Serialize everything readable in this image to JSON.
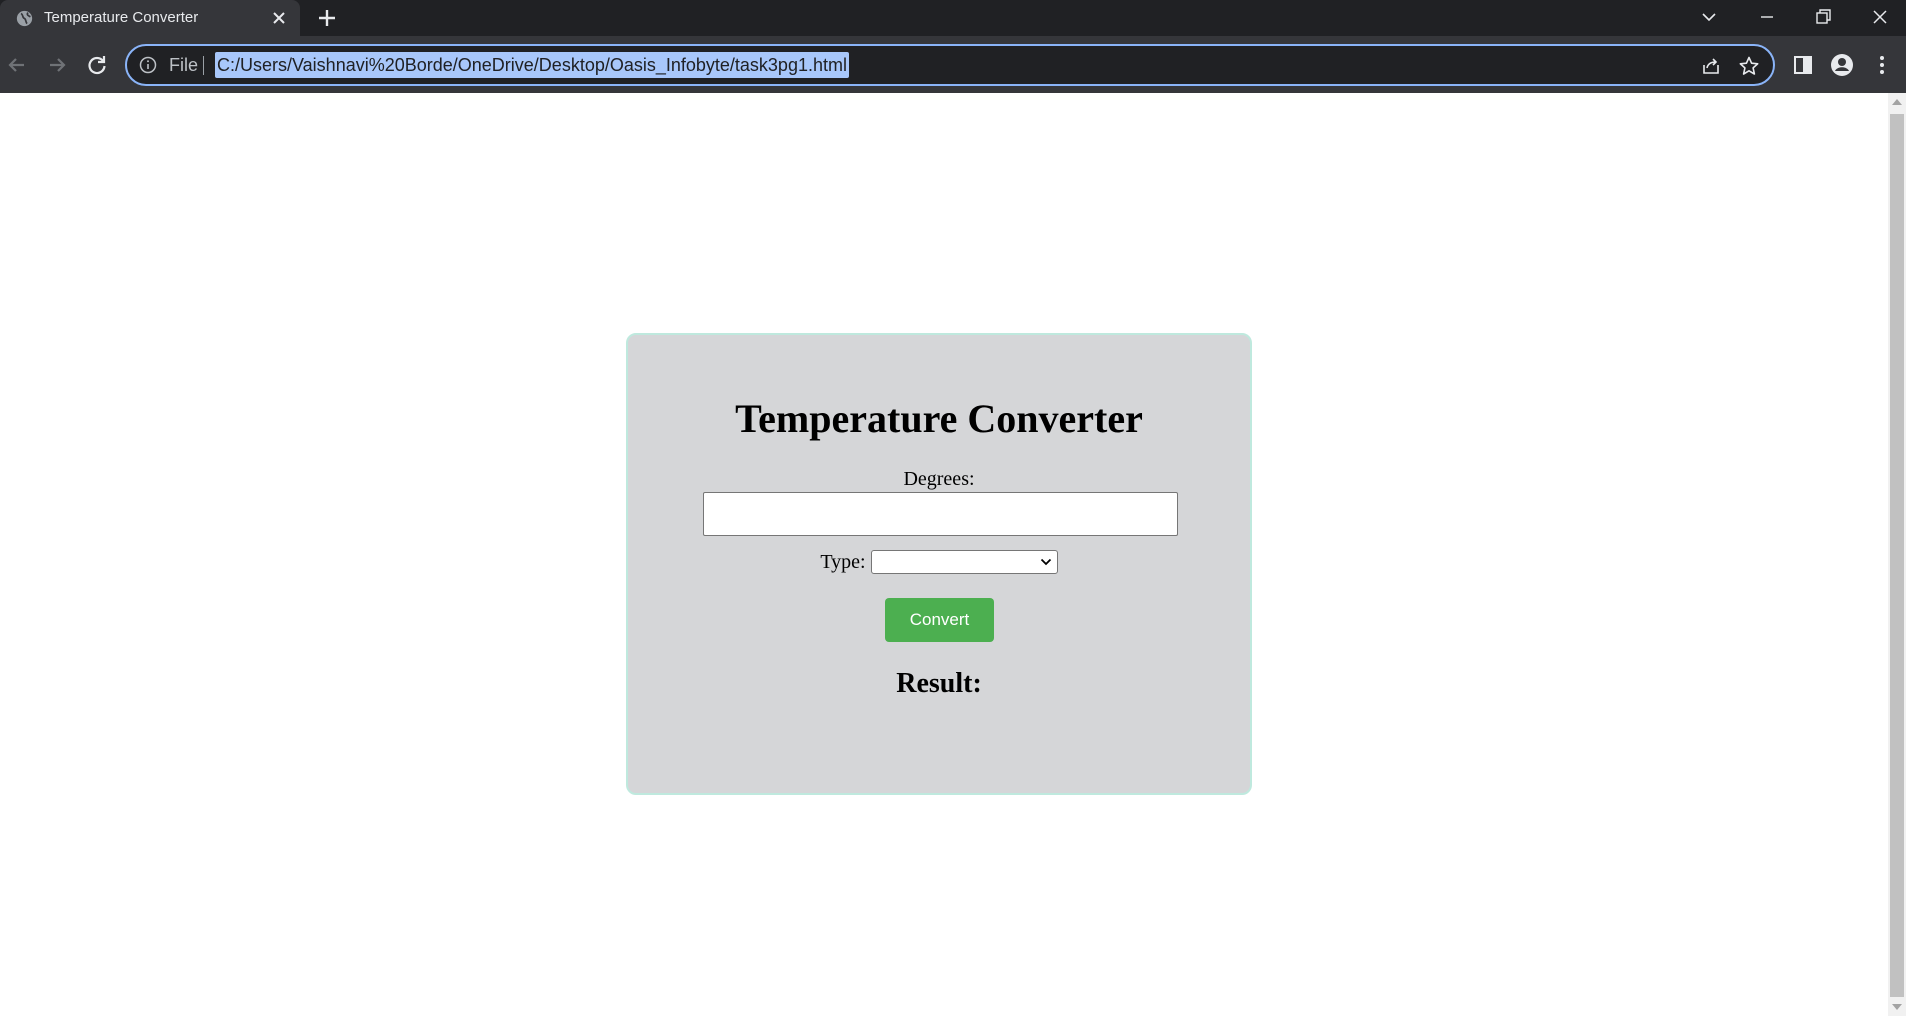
{
  "browser": {
    "tab_title": "Temperature Converter",
    "omnibox": {
      "scheme_label": "File",
      "url": "C:/Users/Vaishnavi%20Borde/OneDrive/Desktop/Oasis_Infobyte/task3pg1.html"
    },
    "icons": {
      "favicon": "globe-icon",
      "tab_close": "close-icon",
      "new_tab": "plus-icon",
      "tab_search": "chevron-down-icon",
      "minimize": "minimize-icon",
      "restore": "restore-icon",
      "close_window": "close-icon",
      "back": "arrow-left-icon",
      "forward": "arrow-right-icon",
      "reload": "reload-icon",
      "site_info": "info-icon",
      "share": "share-icon",
      "bookmark": "star-icon",
      "side_panel": "side-panel-icon",
      "profile": "profile-icon",
      "menu": "kebab-menu-icon"
    }
  },
  "converter": {
    "title": "Temperature Converter",
    "degrees_label": "Degrees:",
    "degrees_value": "",
    "type_label": "Type:",
    "type_selected": "",
    "convert_label": "Convert",
    "result_label": "Result:"
  },
  "colors": {
    "card_background": "#d5d6d8",
    "card_border": "#bfe9de",
    "convert_button": "#4caf50",
    "omnibox_focus": "#8ab4f8",
    "url_selection": "#a8c7fa"
  }
}
